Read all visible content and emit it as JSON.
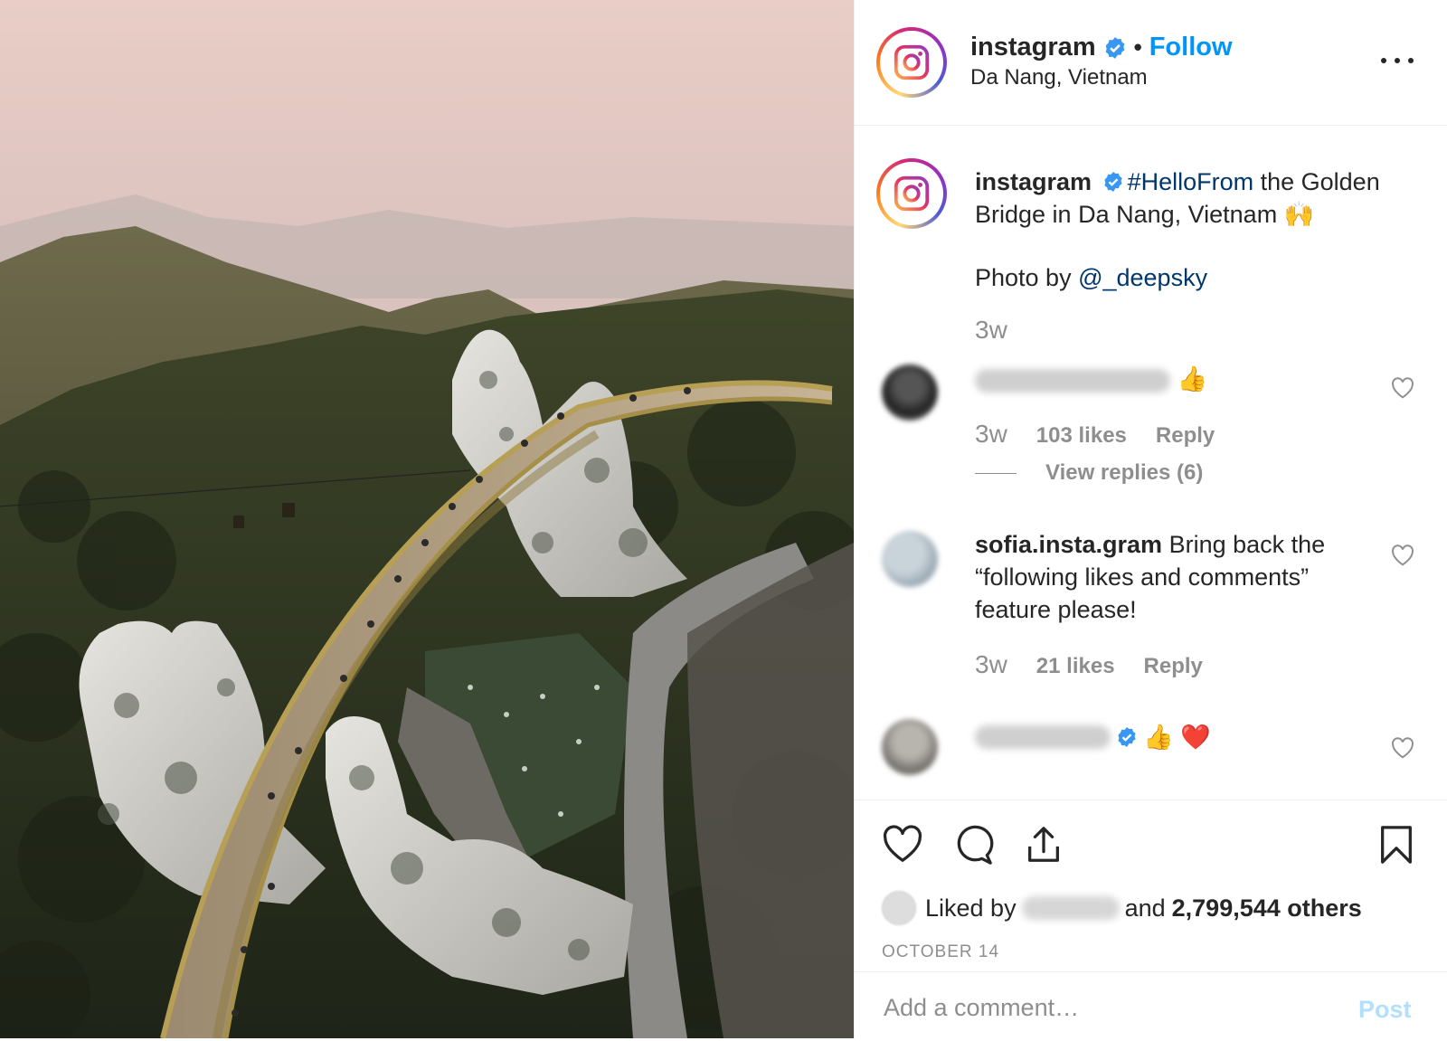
{
  "colors": {
    "accent": "#0095f6",
    "link_dark": "#00376b",
    "secondary_text": "#8e8e8e",
    "divider": "#efefef",
    "post_disabled": "#b2dffc",
    "heart_red": "#ed4956"
  },
  "header": {
    "username": "instagram",
    "separator": "•",
    "follow_label": "Follow",
    "location": "Da Nang, Vietnam",
    "more_icon": "ellipsis-icon"
  },
  "caption": {
    "username": "instagram",
    "hashtag": "#HelloFrom",
    "text": " the Golden Bridge in Da Nang, Vietnam 🙌",
    "photo_by_prefix": "Photo by ",
    "mention": "@_deepsky",
    "time": "3w"
  },
  "comments": [
    {
      "username_hidden": true,
      "text": "👍",
      "time": "3w",
      "likes": "103 likes",
      "reply_label": "Reply",
      "view_replies": "View replies (6)"
    },
    {
      "username": "sofia.insta.gram",
      "text": " Bring back the “following likes and comments” feature please!",
      "time": "3w",
      "likes": "21 likes",
      "reply_label": "Reply"
    },
    {
      "username_hidden": true,
      "text": "👍 ❤️",
      "verified": true
    }
  ],
  "actions": {
    "like_icon": "heart-icon",
    "comment_icon": "comment-icon",
    "share_icon": "share-icon",
    "save_icon": "bookmark-icon",
    "liked_by_prefix": "Liked by",
    "and_label": "and",
    "others": "2,799,544 others",
    "date": "OCTOBER 14"
  },
  "add_comment": {
    "placeholder": "Add a comment…",
    "post_label": "Post"
  }
}
